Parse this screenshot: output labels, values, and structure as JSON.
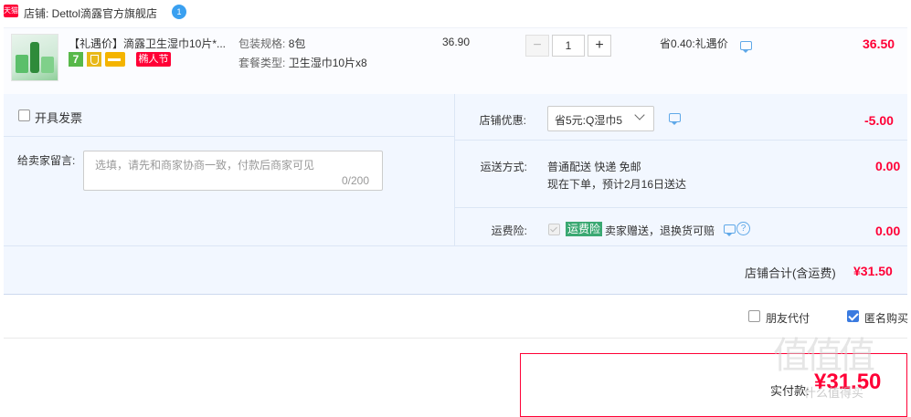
{
  "store": {
    "badge": "天猫",
    "name": "店铺: Dettol滴露官方旗舰店",
    "chat_badge": "1"
  },
  "item": {
    "title": "【礼遇价】滴露卫生湿巾10片*...",
    "badge_seven": "7",
    "badge_festival": "椭人节",
    "spec1_label": "包装规格:",
    "spec1_value": "8包",
    "spec2_label": "套餐类型:",
    "spec2_value": "卫生湿巾10片x8",
    "unit_price": "36.90",
    "quantity": "1",
    "minus": "−",
    "plus": "+",
    "saved": "省0.40:礼遇价",
    "total": "36.50"
  },
  "options": {
    "invoice_label": "开具发票",
    "message_label": "给卖家留言:",
    "message_placeholder": "选填，请先和商家协商一致，付款后商家可见",
    "message_count": "0/200",
    "coupon_label": "店铺优惠:",
    "coupon_value": "省5元:Q湿巾5",
    "coupon_amount": "-5.00",
    "shipping_label": "运送方式:",
    "shipping_line1": "普通配送 快递 免邮",
    "shipping_line2": "现在下单，预计2月16日送达",
    "shipping_amount": "0.00",
    "insurance_label": "运费险:",
    "insurance_tag": "运费险",
    "insurance_desc": "卖家赠送，退换货可赔",
    "insurance_amount": "0.00",
    "store_total_label": "店铺合计(含运费)",
    "store_total_value": "¥31.50"
  },
  "footer": {
    "friend_pay": "朋友代付",
    "anonymous": "匿名购买",
    "anonymous_checked": true,
    "pay_label": "实付款:",
    "pay_value": "¥31.50",
    "watermark": "值值值",
    "watermark_url": "什么值得买"
  },
  "colors": {
    "accent": "#ff0036",
    "panel": "#f2f7ff",
    "link": "#3b7be0",
    "tmall": "#ff0036"
  }
}
